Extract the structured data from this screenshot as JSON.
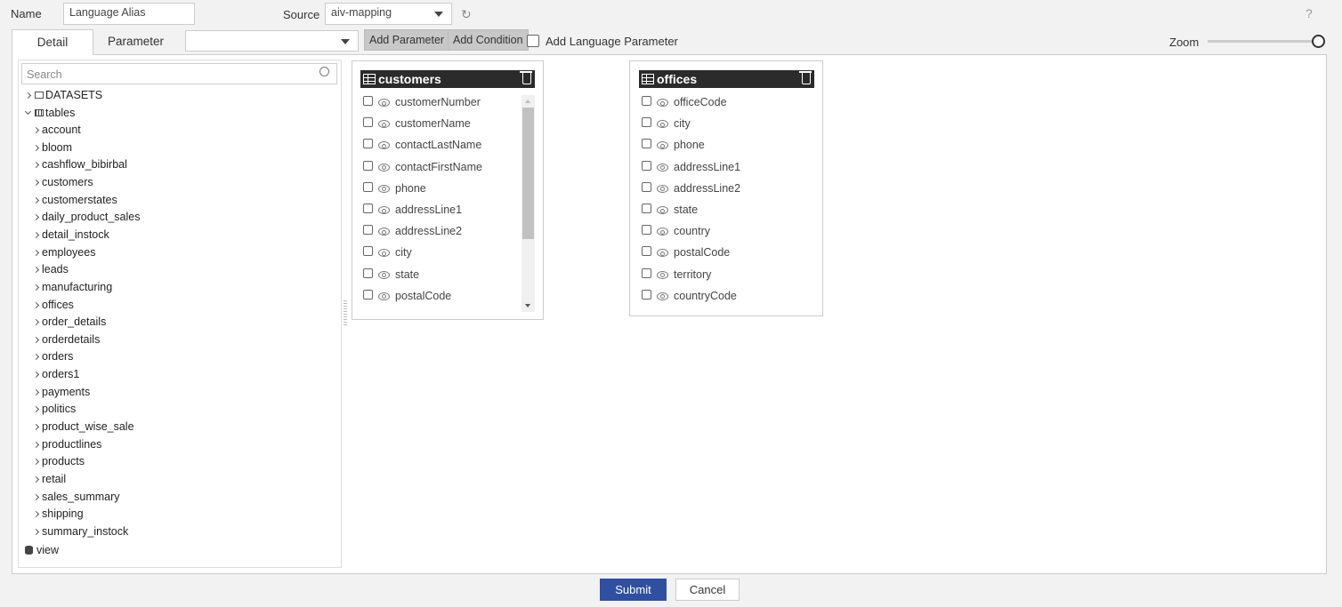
{
  "header": {
    "name_label": "Name",
    "name_value": "Language Alias",
    "source_label": "Source",
    "source_value": "aiv-mapping",
    "help": "?"
  },
  "tabs": [
    {
      "label": "Detail",
      "active": true
    },
    {
      "label": "Parameter",
      "active": false
    }
  ],
  "toolbar": {
    "parameter_select_value": "",
    "add_parameter": "Add Parameter",
    "add_condition": "Add Condition",
    "add_language_parameter": "Add Language Parameter",
    "add_language_parameter_checked": false,
    "zoom_label": "Zoom",
    "zoom_level": 1.0
  },
  "sidebar": {
    "search_placeholder": "Search",
    "datasets": "DATASETS",
    "tables": "tables",
    "items": [
      "account",
      "bloom",
      "cashflow_bibirbal",
      "customers",
      "customerstates",
      "daily_product_sales",
      "detail_instock",
      "employees",
      "leads",
      "manufacturing",
      "offices",
      "order_details",
      "orderdetails",
      "orders",
      "orders1",
      "payments",
      "politics",
      "product_wise_sale",
      "productlines",
      "products",
      "retail",
      "sales_summary",
      "shipping",
      "summary_instock"
    ],
    "view": "view"
  },
  "cards": [
    {
      "title": "customers",
      "fields": [
        "customerNumber",
        "customerName",
        "contactLastName",
        "contactFirstName",
        "phone",
        "addressLine1",
        "addressLine2",
        "city",
        "state",
        "postalCode"
      ]
    },
    {
      "title": "offices",
      "fields": [
        "officeCode",
        "city",
        "phone",
        "addressLine1",
        "addressLine2",
        "state",
        "country",
        "postalCode",
        "territory",
        "countryCode"
      ]
    }
  ],
  "footer": {
    "submit": "Submit",
    "cancel": "Cancel"
  },
  "colors": {
    "submit": "#2f4fa0",
    "card_header": "#2b2b2b"
  }
}
